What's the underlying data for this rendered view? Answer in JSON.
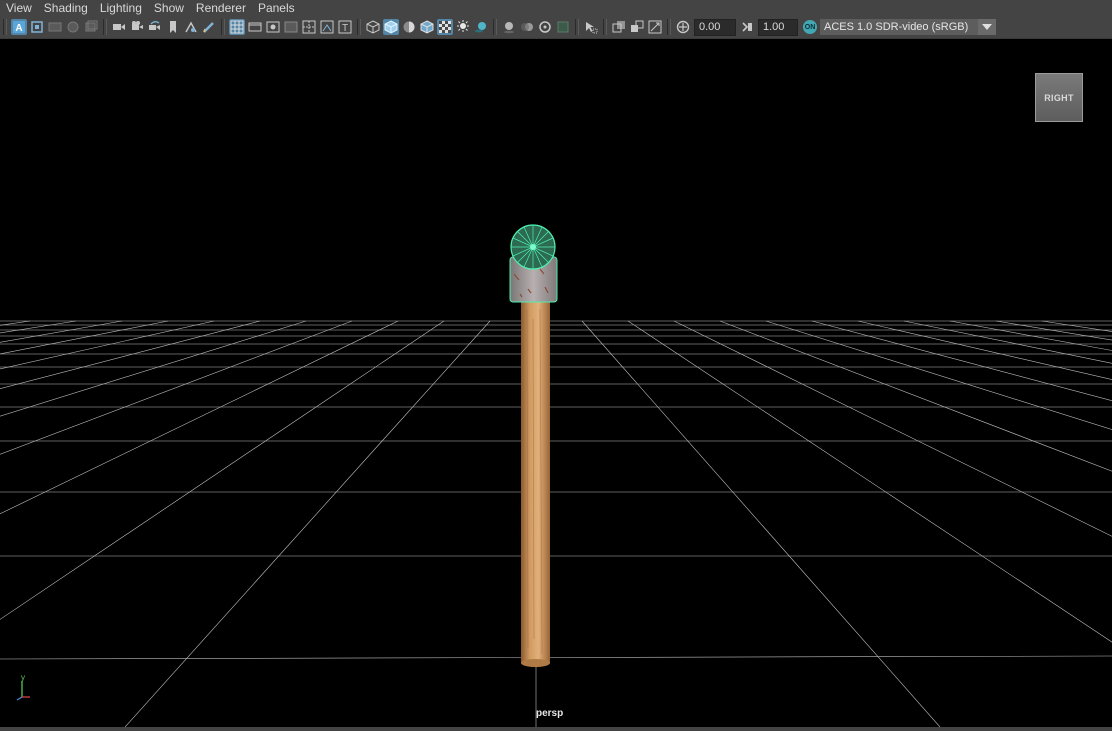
{
  "menubar": {
    "items": [
      "View",
      "Shading",
      "Lighting",
      "Show",
      "Renderer",
      "Panels"
    ]
  },
  "toolbar": {
    "exposure": "0.00",
    "gamma": "1.00",
    "color_management_badge": "ON",
    "color_space": "ACES 1.0 SDR-video (sRGB)",
    "accent_color": "#5285a6"
  },
  "viewport": {
    "camera_label": "persp",
    "viewcube_label": "RIGHT",
    "axis_y_label": "y",
    "background_color": "#000000",
    "grid_color": "#bfbfbf",
    "selection_color": "#4ef0b0"
  },
  "icons": [
    "select-mode-icon",
    "camera-icon",
    "bookmark-icon",
    "grid-icon",
    "wireframe-icon",
    "smooth-shade-icon",
    "textured-icon",
    "lighting-icon",
    "shadow-icon",
    "isolate-icon",
    "xray-icon",
    "exposure-icon",
    "gamma-icon"
  ]
}
